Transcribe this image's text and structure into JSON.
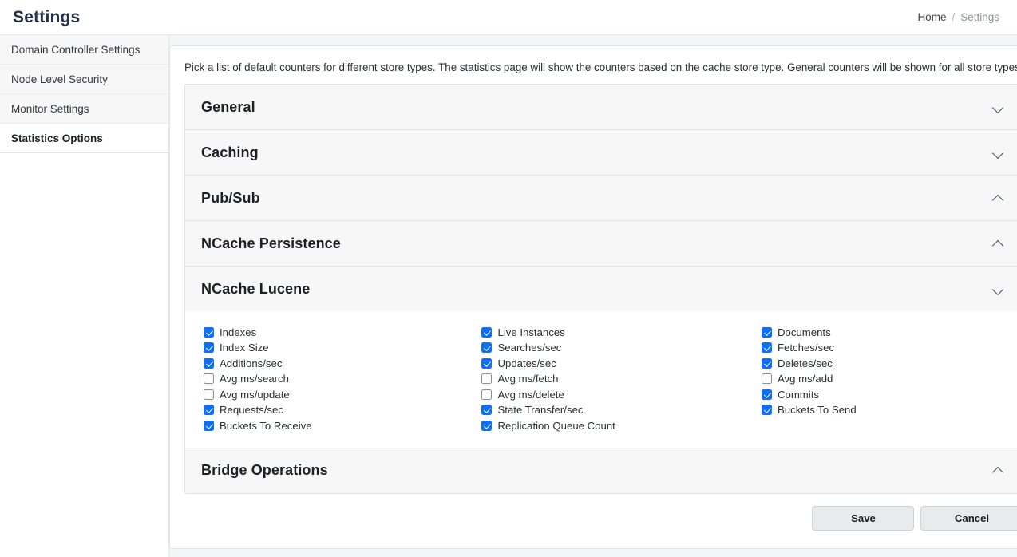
{
  "header": {
    "title": "Settings",
    "breadcrumb": {
      "home": "Home",
      "separator": "/",
      "current": "Settings"
    }
  },
  "sidebar": {
    "items": [
      {
        "label": "Domain Controller Settings",
        "active": false
      },
      {
        "label": "Node Level Security",
        "active": false
      },
      {
        "label": "Monitor Settings",
        "active": false
      },
      {
        "label": "Statistics Options",
        "active": true
      }
    ]
  },
  "main": {
    "description": "Pick a list of default counters for different store types. The statistics page will show the counters based on the cache store type. General counters will be shown for all store types.",
    "sections": [
      {
        "title": "General",
        "chevron": "chevron-down",
        "expanded": false
      },
      {
        "title": "Caching",
        "chevron": "chevron-down",
        "expanded": false
      },
      {
        "title": "Pub/Sub",
        "chevron": "chevron-up",
        "expanded": false
      },
      {
        "title": "NCache Persistence",
        "chevron": "chevron-up",
        "expanded": false
      },
      {
        "title": "NCache Lucene",
        "chevron": "chevron-down",
        "expanded": true
      },
      {
        "title": "Bridge Operations",
        "chevron": "chevron-up",
        "expanded": false
      }
    ],
    "counters": {
      "columns": [
        [
          {
            "label": "Indexes",
            "checked": true
          },
          {
            "label": "Index Size",
            "checked": true
          },
          {
            "label": "Additions/sec",
            "checked": true
          },
          {
            "label": "Avg ms/search",
            "checked": false
          },
          {
            "label": "Avg ms/update",
            "checked": false
          },
          {
            "label": "Requests/sec",
            "checked": true
          },
          {
            "label": "Buckets To Receive",
            "checked": true
          }
        ],
        [
          {
            "label": "Live Instances",
            "checked": true
          },
          {
            "label": "Searches/sec",
            "checked": true
          },
          {
            "label": "Updates/sec",
            "checked": true
          },
          {
            "label": "Avg ms/fetch",
            "checked": false
          },
          {
            "label": "Avg ms/delete",
            "checked": false
          },
          {
            "label": "State Transfer/sec",
            "checked": true
          },
          {
            "label": "Replication Queue Count",
            "checked": true
          }
        ],
        [
          {
            "label": "Documents",
            "checked": true
          },
          {
            "label": "Fetches/sec",
            "checked": true
          },
          {
            "label": "Deletes/sec",
            "checked": true
          },
          {
            "label": "Avg ms/add",
            "checked": false
          },
          {
            "label": "Commits",
            "checked": true
          },
          {
            "label": "Buckets To Send",
            "checked": true
          }
        ]
      ]
    },
    "buttons": {
      "save": "Save",
      "cancel": "Cancel"
    }
  },
  "colors": {
    "accent": "#0d6efd",
    "header_title": "#24324a",
    "panel_bg": "#ffffff",
    "section_header_bg": "#f7f7f8",
    "button_bg": "#e9eaec"
  }
}
